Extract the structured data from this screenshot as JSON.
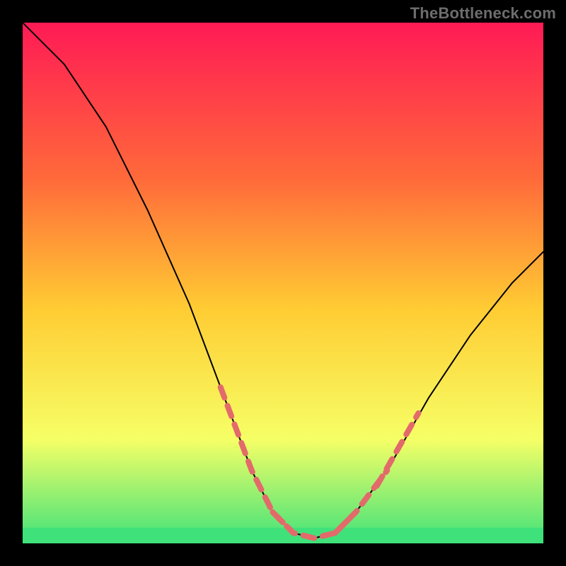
{
  "watermark": "TheBottleneck.com",
  "colors": {
    "background": "#000000",
    "gradient_top": "#ff1a55",
    "gradient_mid_upper": "#ff6a3a",
    "gradient_mid": "#ffcc33",
    "gradient_lower": "#f6ff66",
    "gradient_bottom": "#3fe27a",
    "curve": "#000000",
    "highlight": "#e36a6a"
  },
  "chart_data": {
    "type": "line",
    "title": "",
    "xlabel": "",
    "ylabel": "",
    "xlim": [
      0,
      100
    ],
    "ylim": [
      0,
      100
    ],
    "grid": false,
    "legend": false,
    "series": [
      {
        "name": "bottleneck-curve",
        "x": [
          0,
          8,
          16,
          24,
          32,
          38,
          44,
          48,
          52,
          56,
          60,
          64,
          70,
          78,
          86,
          94,
          100
        ],
        "y": [
          100,
          92,
          80,
          64,
          46,
          30,
          14,
          6,
          2,
          1,
          2,
          6,
          14,
          28,
          40,
          50,
          56
        ]
      }
    ],
    "highlight_segments": [
      {
        "name": "left-descent-dash",
        "x": [
          38,
          44,
          48,
          52
        ],
        "y": [
          30,
          14,
          6,
          2
        ]
      },
      {
        "name": "valley-dash",
        "x": [
          48,
          52,
          56,
          60,
          64
        ],
        "y": [
          6,
          2,
          1,
          2,
          6
        ]
      },
      {
        "name": "right-ascend-dash",
        "x": [
          60,
          64,
          70
        ],
        "y": [
          2,
          6,
          14
        ]
      },
      {
        "name": "right-upper-dash",
        "x": [
          68,
          72,
          76
        ],
        "y": [
          11,
          18,
          25
        ]
      }
    ],
    "green_band_y": [
      0,
      3
    ]
  }
}
